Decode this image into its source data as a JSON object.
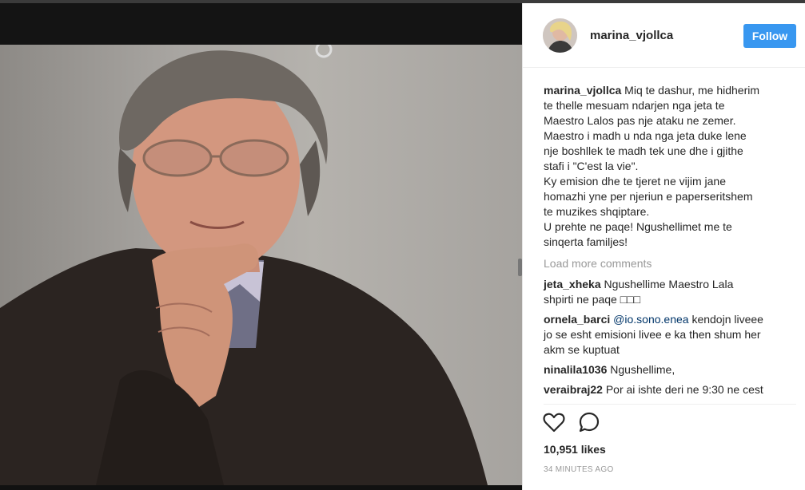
{
  "post": {
    "username": "marina_vjollca",
    "follow_label": "Follow",
    "caption": {
      "username": "marina_vjollca",
      "lines": [
        "Miq te dashur, me hidherim",
        "te thelle mesuam ndarjen nga jeta te",
        "Maestro Lalos pas nje ataku ne zemer.",
        "Maestro i madh u nda nga jeta duke lene",
        "nje boshllek te madh tek une dhe i gjithe",
        "stafi i \"C'est la vie\".",
        "Ky emision dhe te tjeret ne vijim jane",
        "homazhi yne per njeriun e paperseritshem",
        "te muzikes shqiptare.",
        "U prehte ne paqe! Ngushellimet me te",
        "sinqerta familjes!"
      ]
    },
    "load_more": "Load more comments",
    "comments": [
      {
        "username": "jeta_xheka",
        "line1": "Ngushellime Maestro Lala",
        "line2": "shpirti ne paqe □□□"
      },
      {
        "username": "ornela_barci",
        "mention": "@io.sono.enea",
        "line1": "kendojn liveee",
        "line2": "jo se esht emisioni livee e ka then shum her",
        "line3": "akm se kuptuat"
      },
      {
        "username": "ninalila1036",
        "line1": "Ngushellime,"
      },
      {
        "username": "veraibraj22",
        "line1": "Por ai ishte deri ne 9:30 ne cest"
      }
    ],
    "likes": "10,951 likes",
    "timestamp": "34 MINUTES AGO",
    "icons": {
      "like": "heart-icon",
      "comment": "comment-bubble-icon"
    },
    "colors": {
      "follow_bg": "#3897f0",
      "mention": "#003569",
      "muted": "#999999"
    }
  }
}
